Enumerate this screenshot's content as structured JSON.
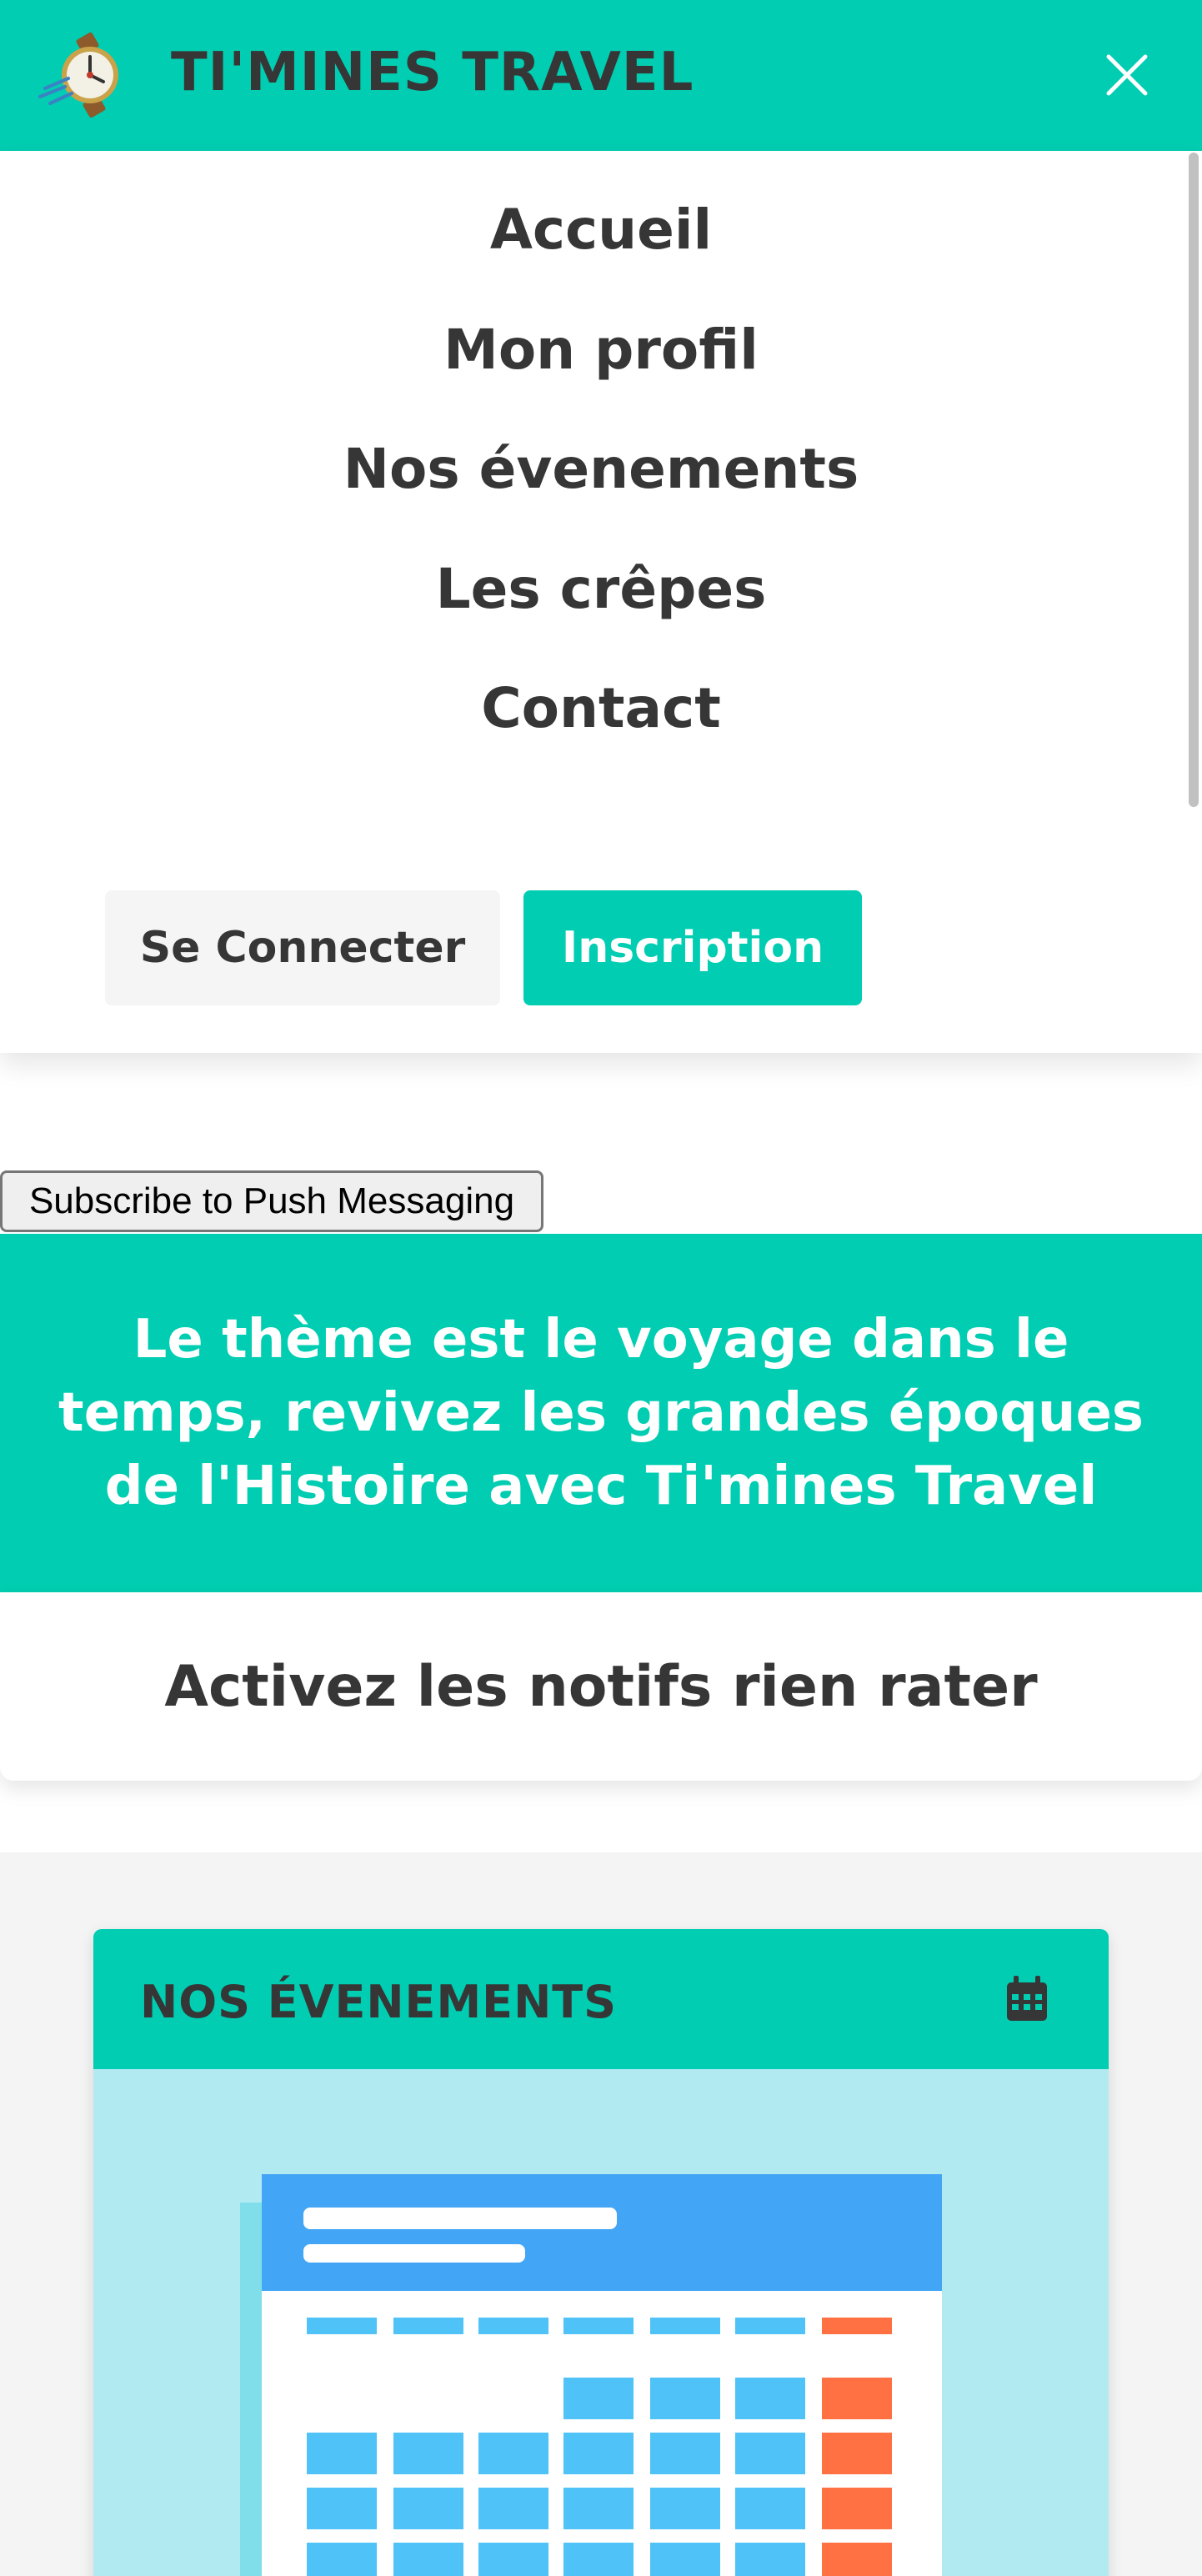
{
  "header": {
    "brand": "TI'MINES TRAVEL",
    "logo_icon": "compass-clock-logo",
    "close_icon": "close-icon"
  },
  "menu": {
    "items": [
      {
        "label": "Accueil"
      },
      {
        "label": "Mon profil"
      },
      {
        "label": "Nos évenements"
      },
      {
        "label": "Les crêpes"
      },
      {
        "label": "Contact"
      }
    ],
    "login_label": "Se Connecter",
    "signup_label": "Inscription"
  },
  "push": {
    "button_label": "Subscribe to Push Messaging"
  },
  "hero": {
    "text": "Le thème est le voyage dans le temps, revivez les grandes époques de l'Histoire avec Ti'mines Travel"
  },
  "notif": {
    "text": "Activez les notifs rien rater"
  },
  "events_card": {
    "title": "NOS ÉVENEMENTS",
    "icon": "calendar-icon",
    "illustration": "calendar-illustration"
  },
  "colors": {
    "accent": "#00cdb1",
    "text_dark": "#363636",
    "card_bg": "#b1ebf1",
    "calendar_blue": "#42a5f5",
    "calendar_cell": "#4fc3f7",
    "calendar_weekend": "#ff7043"
  }
}
